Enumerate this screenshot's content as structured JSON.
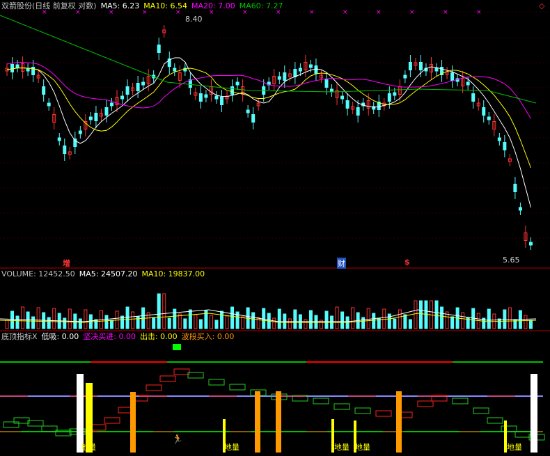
{
  "main_header": {
    "title": "双箭股份(日线 前复权 对数)",
    "ma5": "MA5: 6.23",
    "ma10": "MA10: 6.54",
    "ma20": "MA20: 7.00",
    "ma60": "MA60: 7.27"
  },
  "price_labels": {
    "high": "8.40",
    "low": "5.65"
  },
  "event_marks": {
    "zeng": "增",
    "cai": "财",
    "s": "$"
  },
  "volume_header": {
    "volume": "VOLUME: 12452.50",
    "ma5": "MA5: 24507.20",
    "ma10": "MA10: 19837.00"
  },
  "indicator_header": {
    "name": "底顶指标X",
    "low_buy": "低吸: 0.00",
    "firm_buy": "坚决买进: 0.00",
    "attack": "出击: 0.00",
    "wave_buy": "波段买入: 0.00"
  },
  "bottom_labels": [
    "地量",
    "地量",
    "地量",
    "地量",
    "地量"
  ],
  "colors": {
    "ma5": "#ffffff",
    "ma10": "#ffff00",
    "ma20": "#ff00ff",
    "ma60": "#00c000",
    "up": "#ff3333",
    "down": "#54fcfc",
    "axis": "#b00000"
  }
}
